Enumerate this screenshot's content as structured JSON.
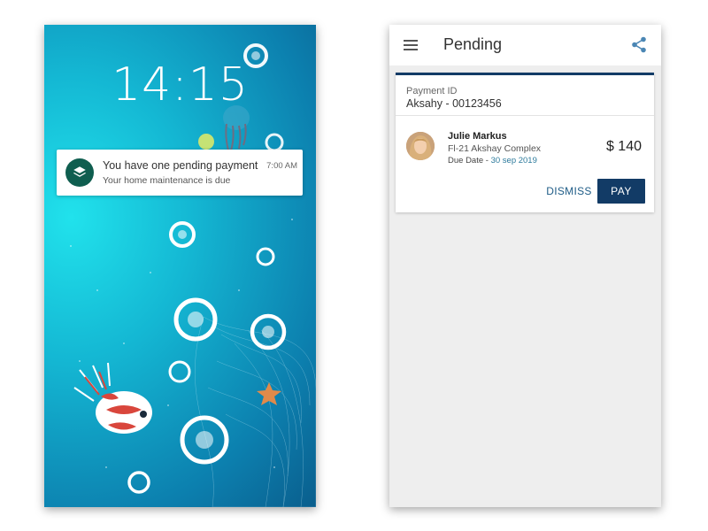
{
  "lock_screen": {
    "time": "14:15",
    "notification": {
      "title": "You have one pending payment",
      "subtitle": "Your home maintenance is due",
      "time": "7:00 AM",
      "icon": "layers-icon"
    }
  },
  "pending_app": {
    "title": "Pending",
    "menu_icon": "hamburger-menu-icon",
    "share_icon": "share-icon",
    "accent_color": "#123b66",
    "card": {
      "payment_id_label": "Payment ID",
      "payment_id_value": "Aksahy - 00123456",
      "payer_name": "Julie Markus",
      "payer_address": "Fl-21 Akshay Complex",
      "due_label": "Due Date - ",
      "due_date": "30 sep 2019",
      "amount": "$ 140",
      "dismiss_label": "DISMISS",
      "pay_label": "PAY"
    }
  }
}
